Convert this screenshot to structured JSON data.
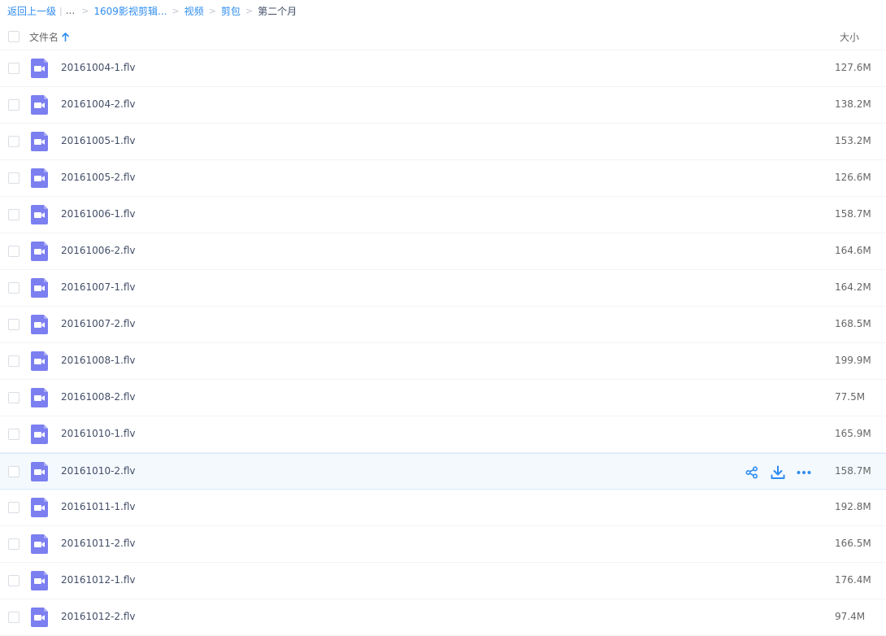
{
  "breadcrumb": {
    "back_label": "返回上一级",
    "separator_bar": "|",
    "ellipsis": "...",
    "sep": ">",
    "items": [
      "1609影视剪辑...",
      "视频",
      "剪包"
    ],
    "current": "第二个月"
  },
  "table": {
    "headers": {
      "name": "文件名",
      "size": "大小"
    },
    "sort": "ascending",
    "rows": [
      {
        "name": "20161004-1.flv",
        "size": "127.6M"
      },
      {
        "name": "20161004-2.flv",
        "size": "138.2M"
      },
      {
        "name": "20161005-1.flv",
        "size": "153.2M"
      },
      {
        "name": "20161005-2.flv",
        "size": "126.6M"
      },
      {
        "name": "20161006-1.flv",
        "size": "158.7M"
      },
      {
        "name": "20161006-2.flv",
        "size": "164.6M"
      },
      {
        "name": "20161007-1.flv",
        "size": "164.2M"
      },
      {
        "name": "20161007-2.flv",
        "size": "168.5M"
      },
      {
        "name": "20161008-1.flv",
        "size": "199.9M"
      },
      {
        "name": "20161008-2.flv",
        "size": "77.5M"
      },
      {
        "name": "20161010-1.flv",
        "size": "165.9M"
      },
      {
        "name": "20161010-2.flv",
        "size": "158.7M",
        "hovered": true
      },
      {
        "name": "20161011-1.flv",
        "size": "192.8M"
      },
      {
        "name": "20161011-2.flv",
        "size": "166.5M"
      },
      {
        "name": "20161012-1.flv",
        "size": "176.4M"
      },
      {
        "name": "20161012-2.flv",
        "size": "97.4M"
      }
    ],
    "row_actions": [
      "share-icon",
      "download-icon",
      "more-icon"
    ]
  },
  "icons": {
    "file": "video-file-icon",
    "sort": "arrow-up-icon"
  },
  "colors": {
    "accent": "#2d8cf0",
    "video_icon": "#7b7ff0",
    "hover_row": "#f4f9fe"
  }
}
